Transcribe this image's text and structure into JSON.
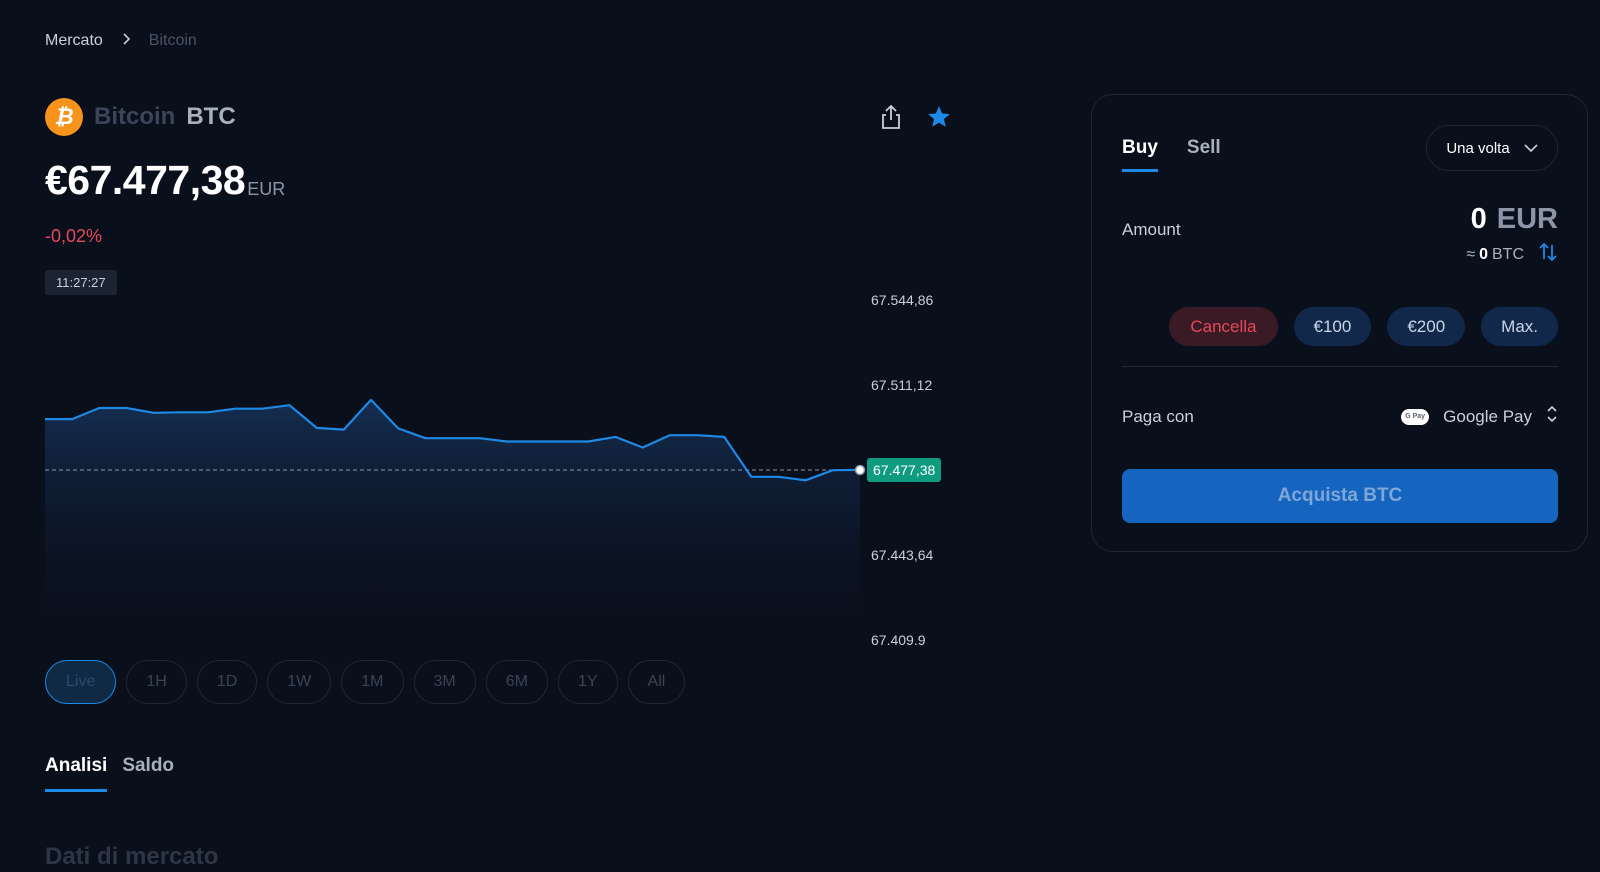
{
  "breadcrumb": {
    "parent": "Mercato",
    "current": "Bitcoin"
  },
  "asset": {
    "name": "Bitcoin",
    "ticker": "BTC",
    "logo_letter": "₿"
  },
  "price": {
    "value": "€67.477,38",
    "currency": "EUR",
    "change": "-0,02%",
    "time": "11:27:27"
  },
  "icons": {
    "share": "share-icon",
    "favorite": "star-icon"
  },
  "chart_data": {
    "type": "area",
    "x": [
      0,
      1,
      2,
      3,
      4,
      5,
      6,
      7,
      8,
      9,
      10,
      11,
      12,
      13,
      14,
      15,
      16,
      17,
      18,
      19,
      20,
      21,
      22,
      23,
      24,
      25,
      26,
      27,
      28,
      29,
      30
    ],
    "values": [
      67497.6,
      67497.6,
      67502.0,
      67502.0,
      67500.1,
      67500.3,
      67500.3,
      67501.7,
      67501.7,
      67503.1,
      67494.1,
      67493.4,
      67505.2,
      67493.9,
      67490.0,
      67490.0,
      67490.0,
      67488.7,
      67488.7,
      67488.7,
      67488.7,
      67490.5,
      67486.3,
      67491.2,
      67491.2,
      67490.5,
      67474.7,
      67474.7,
      67473.3,
      67477.3,
      67477.4
    ],
    "y_ticks": [
      "67.544,86",
      "67.511,12",
      "67.443,64",
      "67.409.9"
    ],
    "ylim": [
      67409.9,
      67544.86
    ],
    "current_label": "67.477,38",
    "current_value": 67477.38,
    "line_color": "#1e88e5",
    "tag_color": "#0f9b80"
  },
  "periods": [
    "Live",
    "1H",
    "1D",
    "1W",
    "1M",
    "3M",
    "6M",
    "1Y",
    "All"
  ],
  "tabs": {
    "analysis": "Analisi",
    "balance": "Saldo"
  },
  "section_title": "Dati di mercato",
  "trade": {
    "buy": "Buy",
    "sell": "Sell",
    "frequency": "Una volta",
    "amount_label": "Amount",
    "amount_value": "0",
    "amount_currency": "EUR",
    "approx": "≈",
    "btc_value": "0",
    "btc_unit": "BTC",
    "quick": {
      "cancel": "Cancella",
      "q1": "€100",
      "q2": "€200",
      "max": "Max."
    },
    "pay_label": "Paga con",
    "pay_method": "Google Pay",
    "gpay_badge": "G Pay",
    "submit": "Acquista BTC"
  }
}
